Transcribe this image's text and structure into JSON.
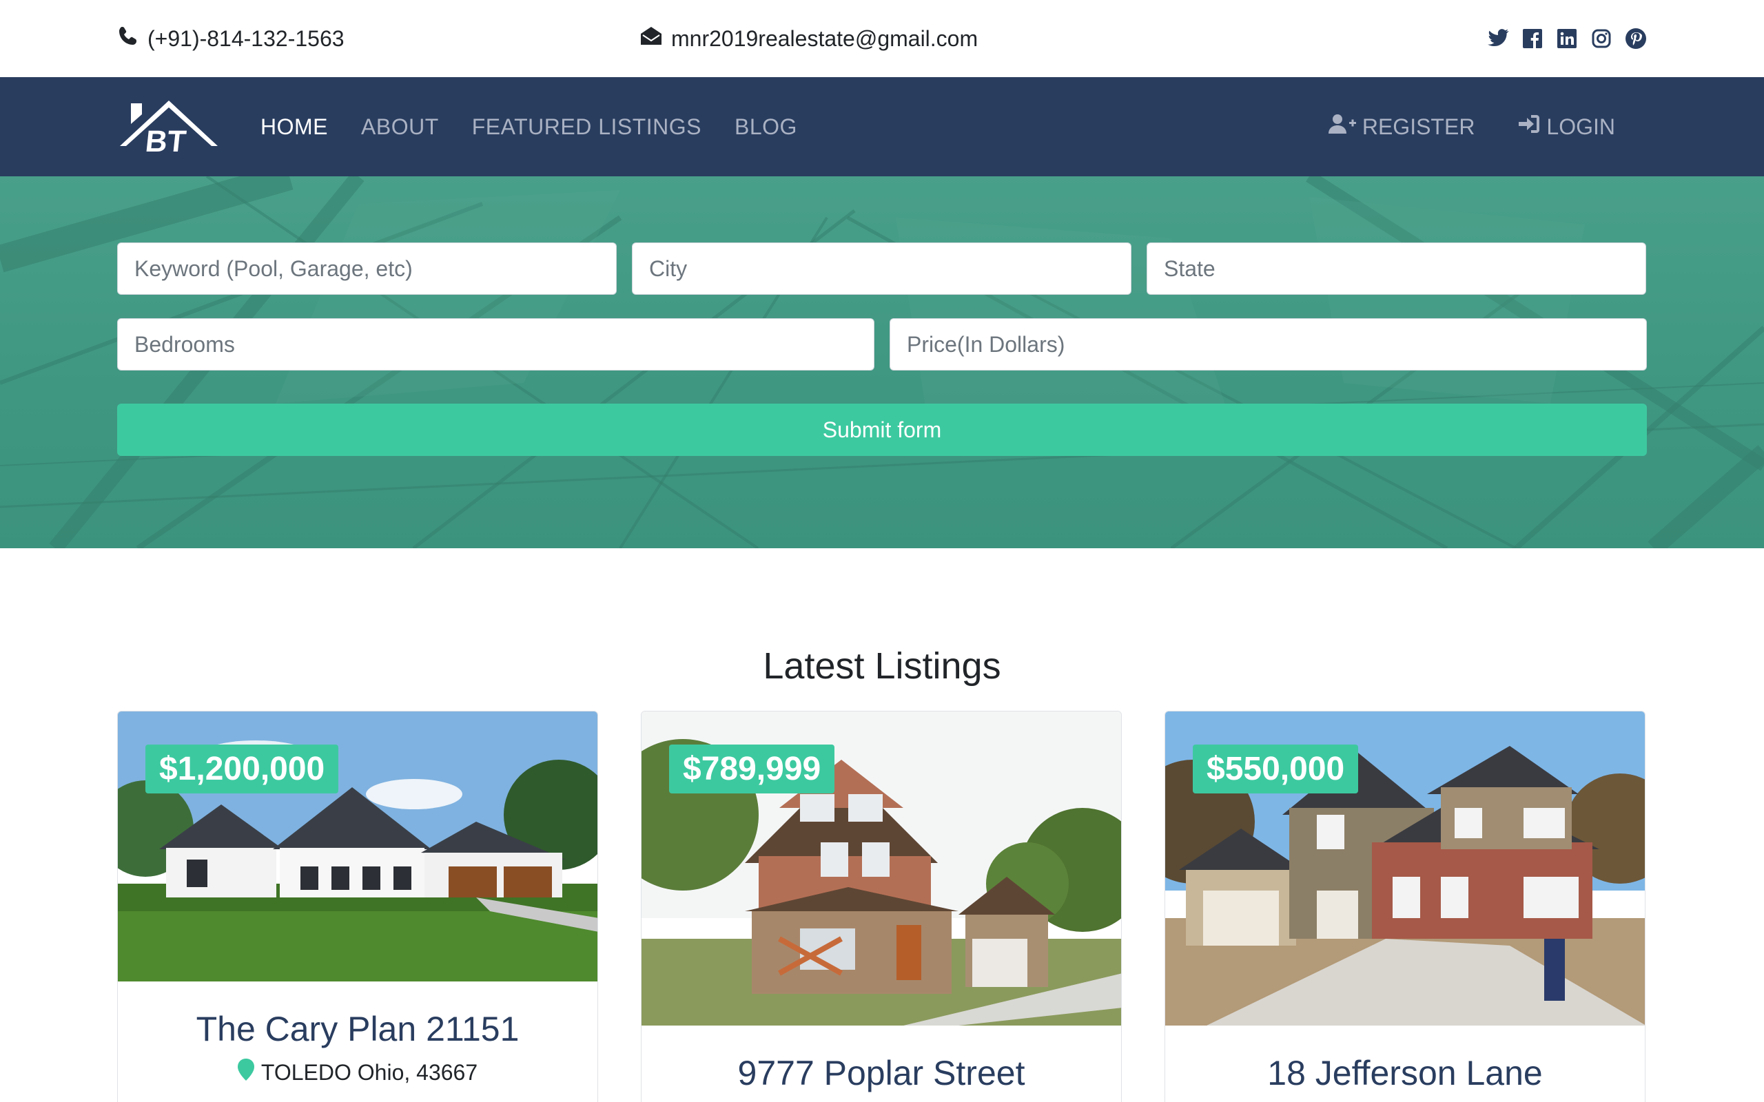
{
  "topbar": {
    "phone": "(+91)-814-132-1563",
    "email": "mnr2019realestate@gmail.com",
    "social": [
      "twitter-icon",
      "facebook-icon",
      "linkedin-icon",
      "instagram-icon",
      "pinterest-icon"
    ]
  },
  "nav": {
    "logo_text": "BT",
    "links": [
      "HOME",
      "ABOUT",
      "FEATURED LISTINGS",
      "BLOG"
    ],
    "register": "REGISTER",
    "login": "LOGIN"
  },
  "search": {
    "keyword_placeholder": "Keyword (Pool, Garage, etc)",
    "city_placeholder": "City",
    "state_placeholder": "State",
    "bedrooms_placeholder": "Bedrooms",
    "price_placeholder": "Price(In Dollars)",
    "submit": "Submit form"
  },
  "listings": {
    "heading": "Latest Listings",
    "items": [
      {
        "price": "$1,200,000",
        "title": "The Cary Plan 21151",
        "location": "TOLEDO Ohio, 43667"
      },
      {
        "price": "$789,999",
        "title": "9777 Poplar Street",
        "location": ""
      },
      {
        "price": "$550,000",
        "title": "18 Jefferson Lane",
        "location": ""
      }
    ]
  },
  "colors": {
    "navy": "#293d5f",
    "accent": "#3dc9a0",
    "hero": "#4f9f8b"
  }
}
